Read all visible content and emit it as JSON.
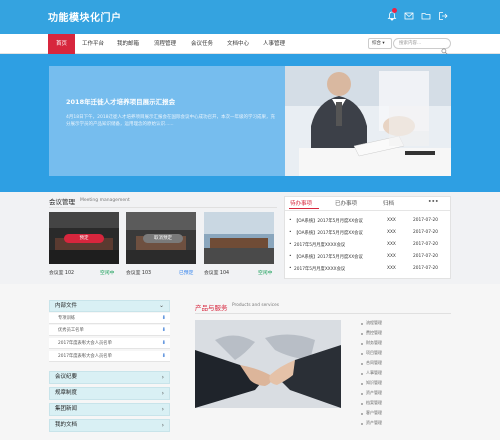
{
  "header": {
    "title": "功能模块化门户",
    "icons": [
      "bell-icon",
      "mail-icon",
      "folder-icon",
      "logout-icon"
    ]
  },
  "nav": {
    "items": [
      "首页",
      "工作平台",
      "我的邮箱",
      "流程管理",
      "会议任务",
      "文档中心",
      "人事管理"
    ],
    "active_index": 0,
    "search_select": "综合",
    "search_placeholder": "搜索内容..."
  },
  "hero": {
    "title": "2018年迁徙人才培养项目展示汇报会",
    "description": "4月18日下午，2018迁徙人才培养项目展示汇报会在国际会议中心成功召开，本次一年级的学习成果，充分展示学员的产品知识储备，运用理念的原始认识......"
  },
  "meeting": {
    "title": "会议管理",
    "subtitle": "Meeting management",
    "rooms": [
      {
        "name": "会议室 102",
        "status": "空闲中",
        "status_color": "#18a058",
        "button": "预定",
        "button_color": "#d7263d"
      },
      {
        "name": "会议室 103",
        "status": "已预定",
        "status_color": "#2f80ed",
        "button": "取消预定",
        "button_color": "#7a7a7a"
      },
      {
        "name": "会议室 104",
        "status": "空闲中",
        "status_color": "#18a058",
        "button": "",
        "button_color": ""
      }
    ]
  },
  "todo": {
    "tabs": [
      "待办事项",
      "已办事项",
      "归档",
      "•••"
    ],
    "active_tab": 0,
    "rows": [
      {
        "title": "【OA系统】2017年5月月度XX会议",
        "user": "XXX",
        "date": "2017-07-20"
      },
      {
        "title": "【OA系统】2017年5月月度XX会议",
        "user": "XXX",
        "date": "2017-07-20"
      },
      {
        "title": "2017年5月月度XXXX会议",
        "user": "XXX",
        "date": "2017-07-20"
      },
      {
        "title": "【OA系统】2017年5月月度XX会议",
        "user": "XXX",
        "date": "2017-07-20"
      },
      {
        "title": "2017年5月月度XXXX会议",
        "user": "XXX",
        "date": "2017-07-20"
      }
    ]
  },
  "sidebar": {
    "section": "内部文件",
    "files": [
      "专项训练",
      "优秀员工名单",
      "2017年度表彰大会人员名单",
      "2017年度表彰大会人员名单"
    ],
    "categories": [
      "会议纪要",
      "规章制度",
      "集团新闻",
      "我的文档"
    ]
  },
  "products": {
    "title": "产品与服务",
    "subtitle": "Products and services",
    "items": [
      "流程管理",
      "费控管理",
      "财务管理",
      "项目管理",
      "合同管理",
      "人事管理",
      "知识管理",
      "资产管理",
      "档案管理",
      "客户管理",
      "资产管理"
    ]
  },
  "colors": {
    "brand_blue": "#34a3e0",
    "accent_red": "#d7263d"
  }
}
